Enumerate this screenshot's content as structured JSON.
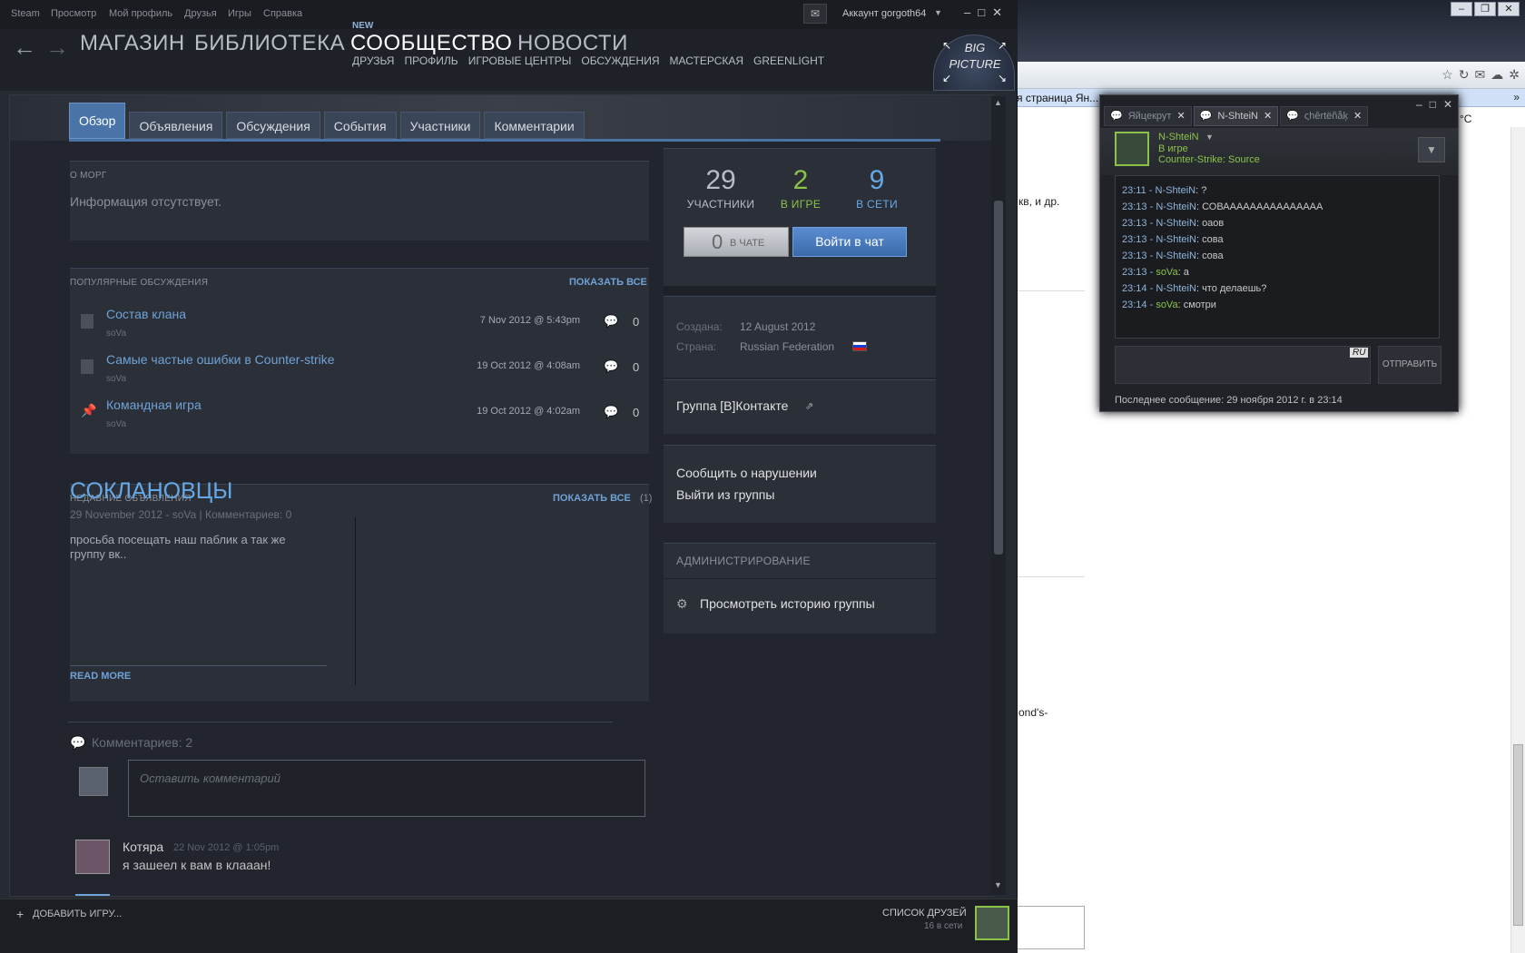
{
  "menubar": {
    "items": [
      "Steam",
      "Просмотр",
      "Мой профиль",
      "Друзья",
      "Игры",
      "Справка"
    ],
    "account": "Аккаунт gorgoth64"
  },
  "nav": {
    "store": "МАГАЗИН",
    "library": "БИБЛИОТЕКА",
    "community": "СООБЩЕСТВО",
    "community_badge": "NEW",
    "news": "НОВОСТИ",
    "sub": [
      "ДРУЗЬЯ",
      "ПРОФИЛЬ",
      "ИГРОВЫЕ ЦЕНТРЫ",
      "ОБСУЖДЕНИЯ",
      "МАСТЕРСКАЯ",
      "GREENLIGHT"
    ],
    "bigpicture_top": "BIG",
    "bigpicture_bottom": "PICTURE"
  },
  "tabs": [
    "Обзор",
    "Объявления",
    "Обсуждения",
    "События",
    "Участники",
    "Комментарии"
  ],
  "about": {
    "label": "О МОРГ",
    "text": "Информация отсутствует."
  },
  "discussions": {
    "label": "ПОПУЛЯРНЫЕ ОБСУЖДЕНИЯ",
    "show_all": "ПОКАЗАТЬ ВСЕ",
    "items": [
      {
        "title": "Состав клана",
        "author": "soVa",
        "date": "7 Nov 2012 @ 5:43pm",
        "count": "0"
      },
      {
        "title": "Самые частые ошибки в Counter-strike",
        "author": "soVa",
        "date": "19 Oct 2012 @ 4:08am",
        "count": "0"
      },
      {
        "title": "Командная игра",
        "author": "soVa",
        "date": "19 Oct 2012 @ 4:02am",
        "count": "0"
      }
    ]
  },
  "announcements": {
    "label": "НЕДАВНИЕ ОБЪЯВЛЕНИЯ",
    "show_all": "ПОКАЗАТЬ ВСЕ",
    "show_all_count": "(1)",
    "title": "СОКЛАНОВЦЫ",
    "meta": "29 November 2012 - soVa | Комментариев: 0",
    "body": "просьба посещать наш паблик а так же группу вк..",
    "read_more": "READ MORE"
  },
  "comments": {
    "count_label": "Комментариев: 2",
    "placeholder": "Оставить комментарий",
    "first": {
      "name": "Котяра",
      "date": "22 Nov 2012 @ 1:05pm",
      "text": "я зашеел к вам в клааан!"
    }
  },
  "stats": {
    "members": "29",
    "members_label": "УЧАСТНИКИ",
    "in_game": "2",
    "in_game_label": "В ИГРЕ",
    "online": "9",
    "online_label": "В СЕТИ",
    "chat_count": "0",
    "chat_label": "В ЧАТЕ",
    "join_chat": "Войти в чат"
  },
  "info": {
    "created_label": "Создана:",
    "created": "12 August 2012",
    "country_label": "Страна:",
    "country": "Russian Federation"
  },
  "links": {
    "vk": "Группа [В]Контакте",
    "report": "Сообщить о нарушении",
    "leave": "Выйти из группы"
  },
  "admin": {
    "label": "АДМИНИСТРИРОВАНИЕ",
    "history": "Просмотреть историю группы"
  },
  "bottom": {
    "add_game": "ДОБАВИТЬ ИГРУ...",
    "friends": "СПИСОК ДРУЗЕЙ",
    "friends_online": "16 в сети"
  },
  "chat": {
    "tabs": [
      "Яйцекрут",
      "N-ShteiN",
      "ςhêrtëñåķ"
    ],
    "name": "N-ShteiN",
    "status": "В игре",
    "game": "Counter-Strike: Source",
    "lines": [
      {
        "time": "23:11",
        "name": "N-ShteiN",
        "text": "?",
        "self": false
      },
      {
        "time": "23:13",
        "name": "N-ShteiN",
        "text": "СОВААААААААААААААА",
        "self": false
      },
      {
        "time": "23:13",
        "name": "N-ShteiN",
        "text": "оаов",
        "self": false
      },
      {
        "time": "23:13",
        "name": "N-ShteiN",
        "text": "сова",
        "self": false
      },
      {
        "time": "23:13",
        "name": "N-ShteiN",
        "text": "сова",
        "self": false
      },
      {
        "time": "23:13",
        "name": "soVa",
        "text": "а",
        "self": true
      },
      {
        "time": "23:14",
        "name": "N-ShteiN",
        "text": "что делаешь?",
        "self": false
      },
      {
        "time": "23:14",
        "name": "soVa",
        "text": "смотри",
        "self": true
      }
    ],
    "lang": "RU",
    "send": "ОТПРАВИТЬ",
    "last_message": "Последнее сообщение: 29 ноября 2012 г. в 23:14"
  },
  "browser": {
    "tab_text": "я страница Ян...",
    "weather": "°C",
    "snippets": [
      "кв, и др.",
      "ond's-"
    ]
  },
  "colors": {
    "accent": "#4a74a8",
    "link": "#6fa2d6",
    "ingame": "#8bc34a",
    "online": "#66a8e6"
  }
}
